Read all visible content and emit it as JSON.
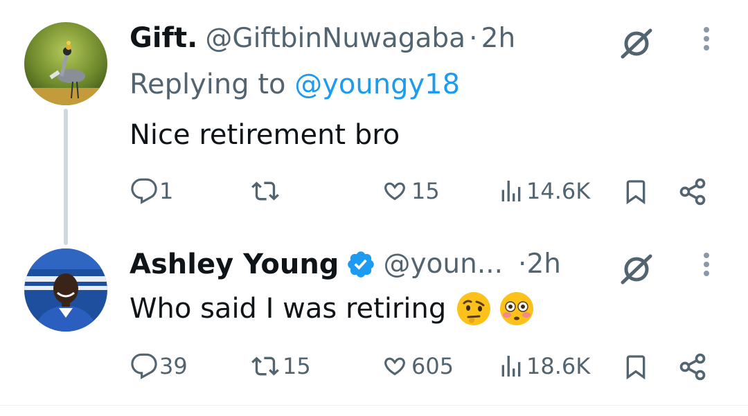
{
  "tweets": [
    {
      "display_name": "Gift.",
      "handle": "@GiftbinNuwagaba",
      "separator": "·",
      "time": "2h",
      "replying_prefix": "Replying to",
      "replying_handle": "@youngy18",
      "text": "Nice retirement bro",
      "stats": {
        "replies": "1",
        "retweets": "",
        "likes": "15",
        "views": "14.6K"
      }
    },
    {
      "display_name": "Ashley Young",
      "verified": true,
      "handle": "@youn...",
      "separator": "·",
      "time": "2h",
      "text": "Who said I was retiring",
      "emojis": [
        "raised-eyebrow-face",
        "flushed-face"
      ],
      "stats": {
        "replies": "39",
        "retweets": "15",
        "likes": "605",
        "views": "18.6K"
      }
    }
  ],
  "colors": {
    "accent": "#1d9bf0",
    "muted": "#536471",
    "text": "#0f1419",
    "thread_line": "#cfd9de"
  },
  "icons": [
    "grok-icon",
    "more-icon",
    "reply-icon",
    "retweet-icon",
    "like-icon",
    "views-icon",
    "bookmark-icon",
    "share-icon",
    "verified-badge-icon"
  ]
}
